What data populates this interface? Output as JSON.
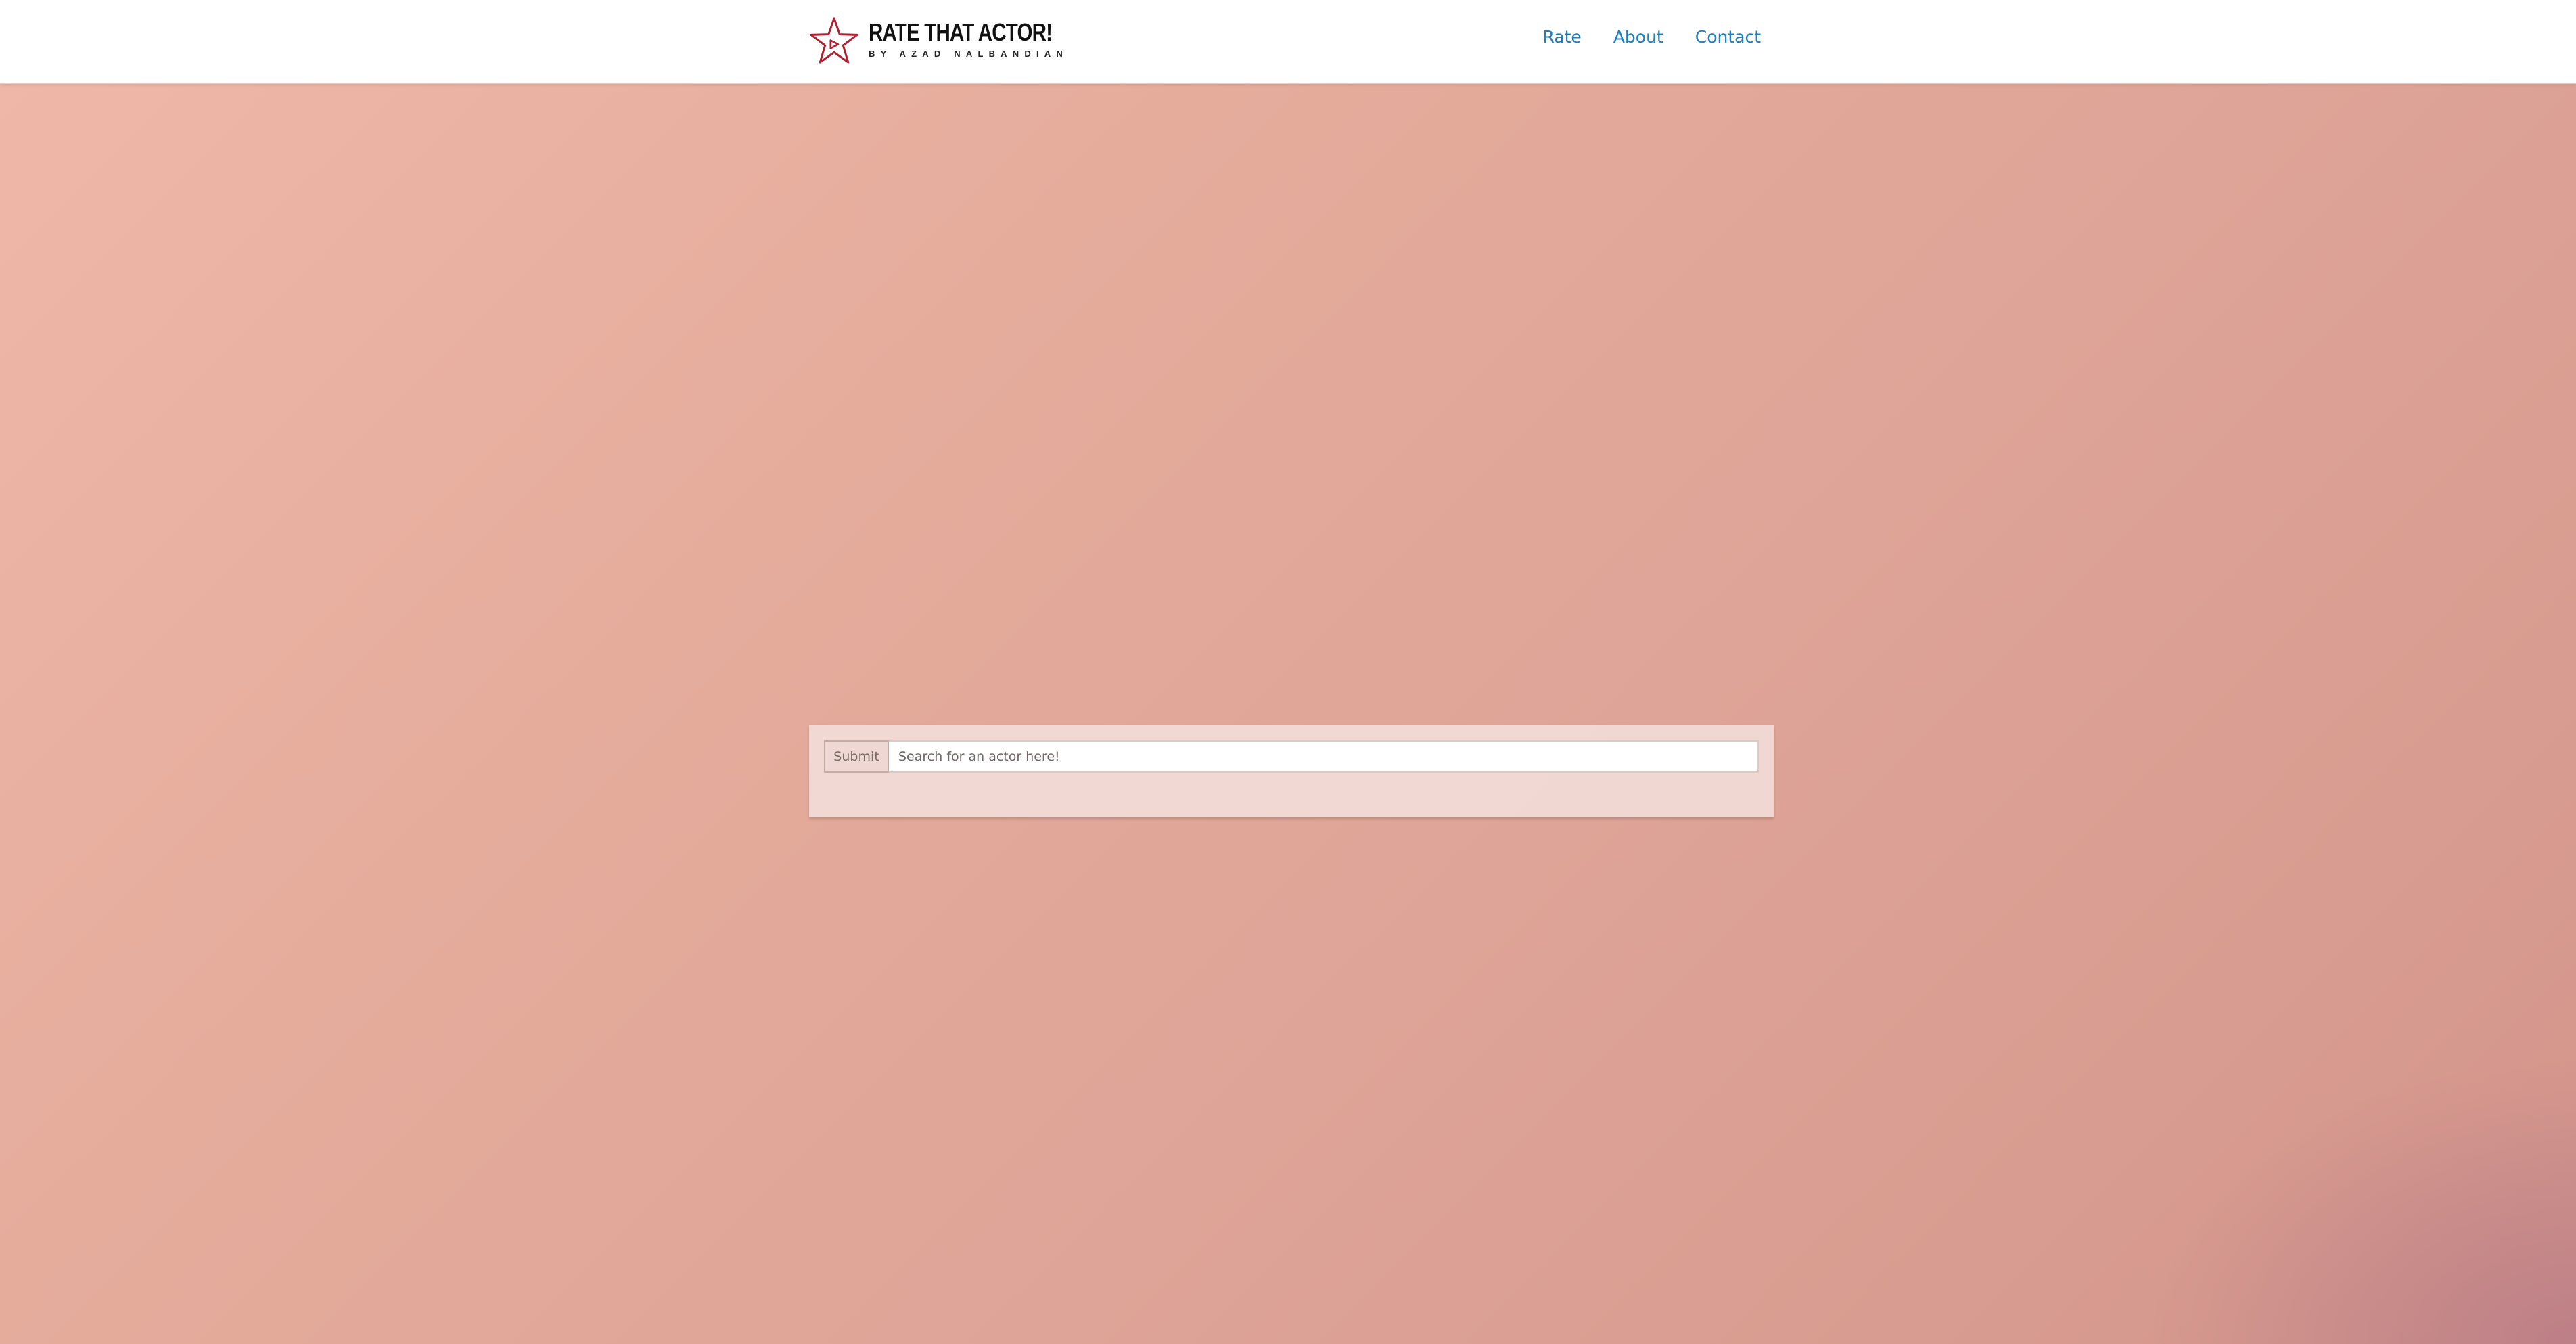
{
  "header": {
    "logo": {
      "title": "RATE THAT ACTOR!",
      "subtitle": "BY AZAD NALBANDIAN",
      "icon": "star-play-icon",
      "icon_color": "#b0202e"
    },
    "nav": [
      {
        "label": "Rate"
      },
      {
        "label": "About"
      },
      {
        "label": "Contact"
      }
    ],
    "nav_color": "#1a7fc4"
  },
  "search": {
    "button_label": "Submit",
    "placeholder": "Search for an actor here!",
    "value": ""
  }
}
